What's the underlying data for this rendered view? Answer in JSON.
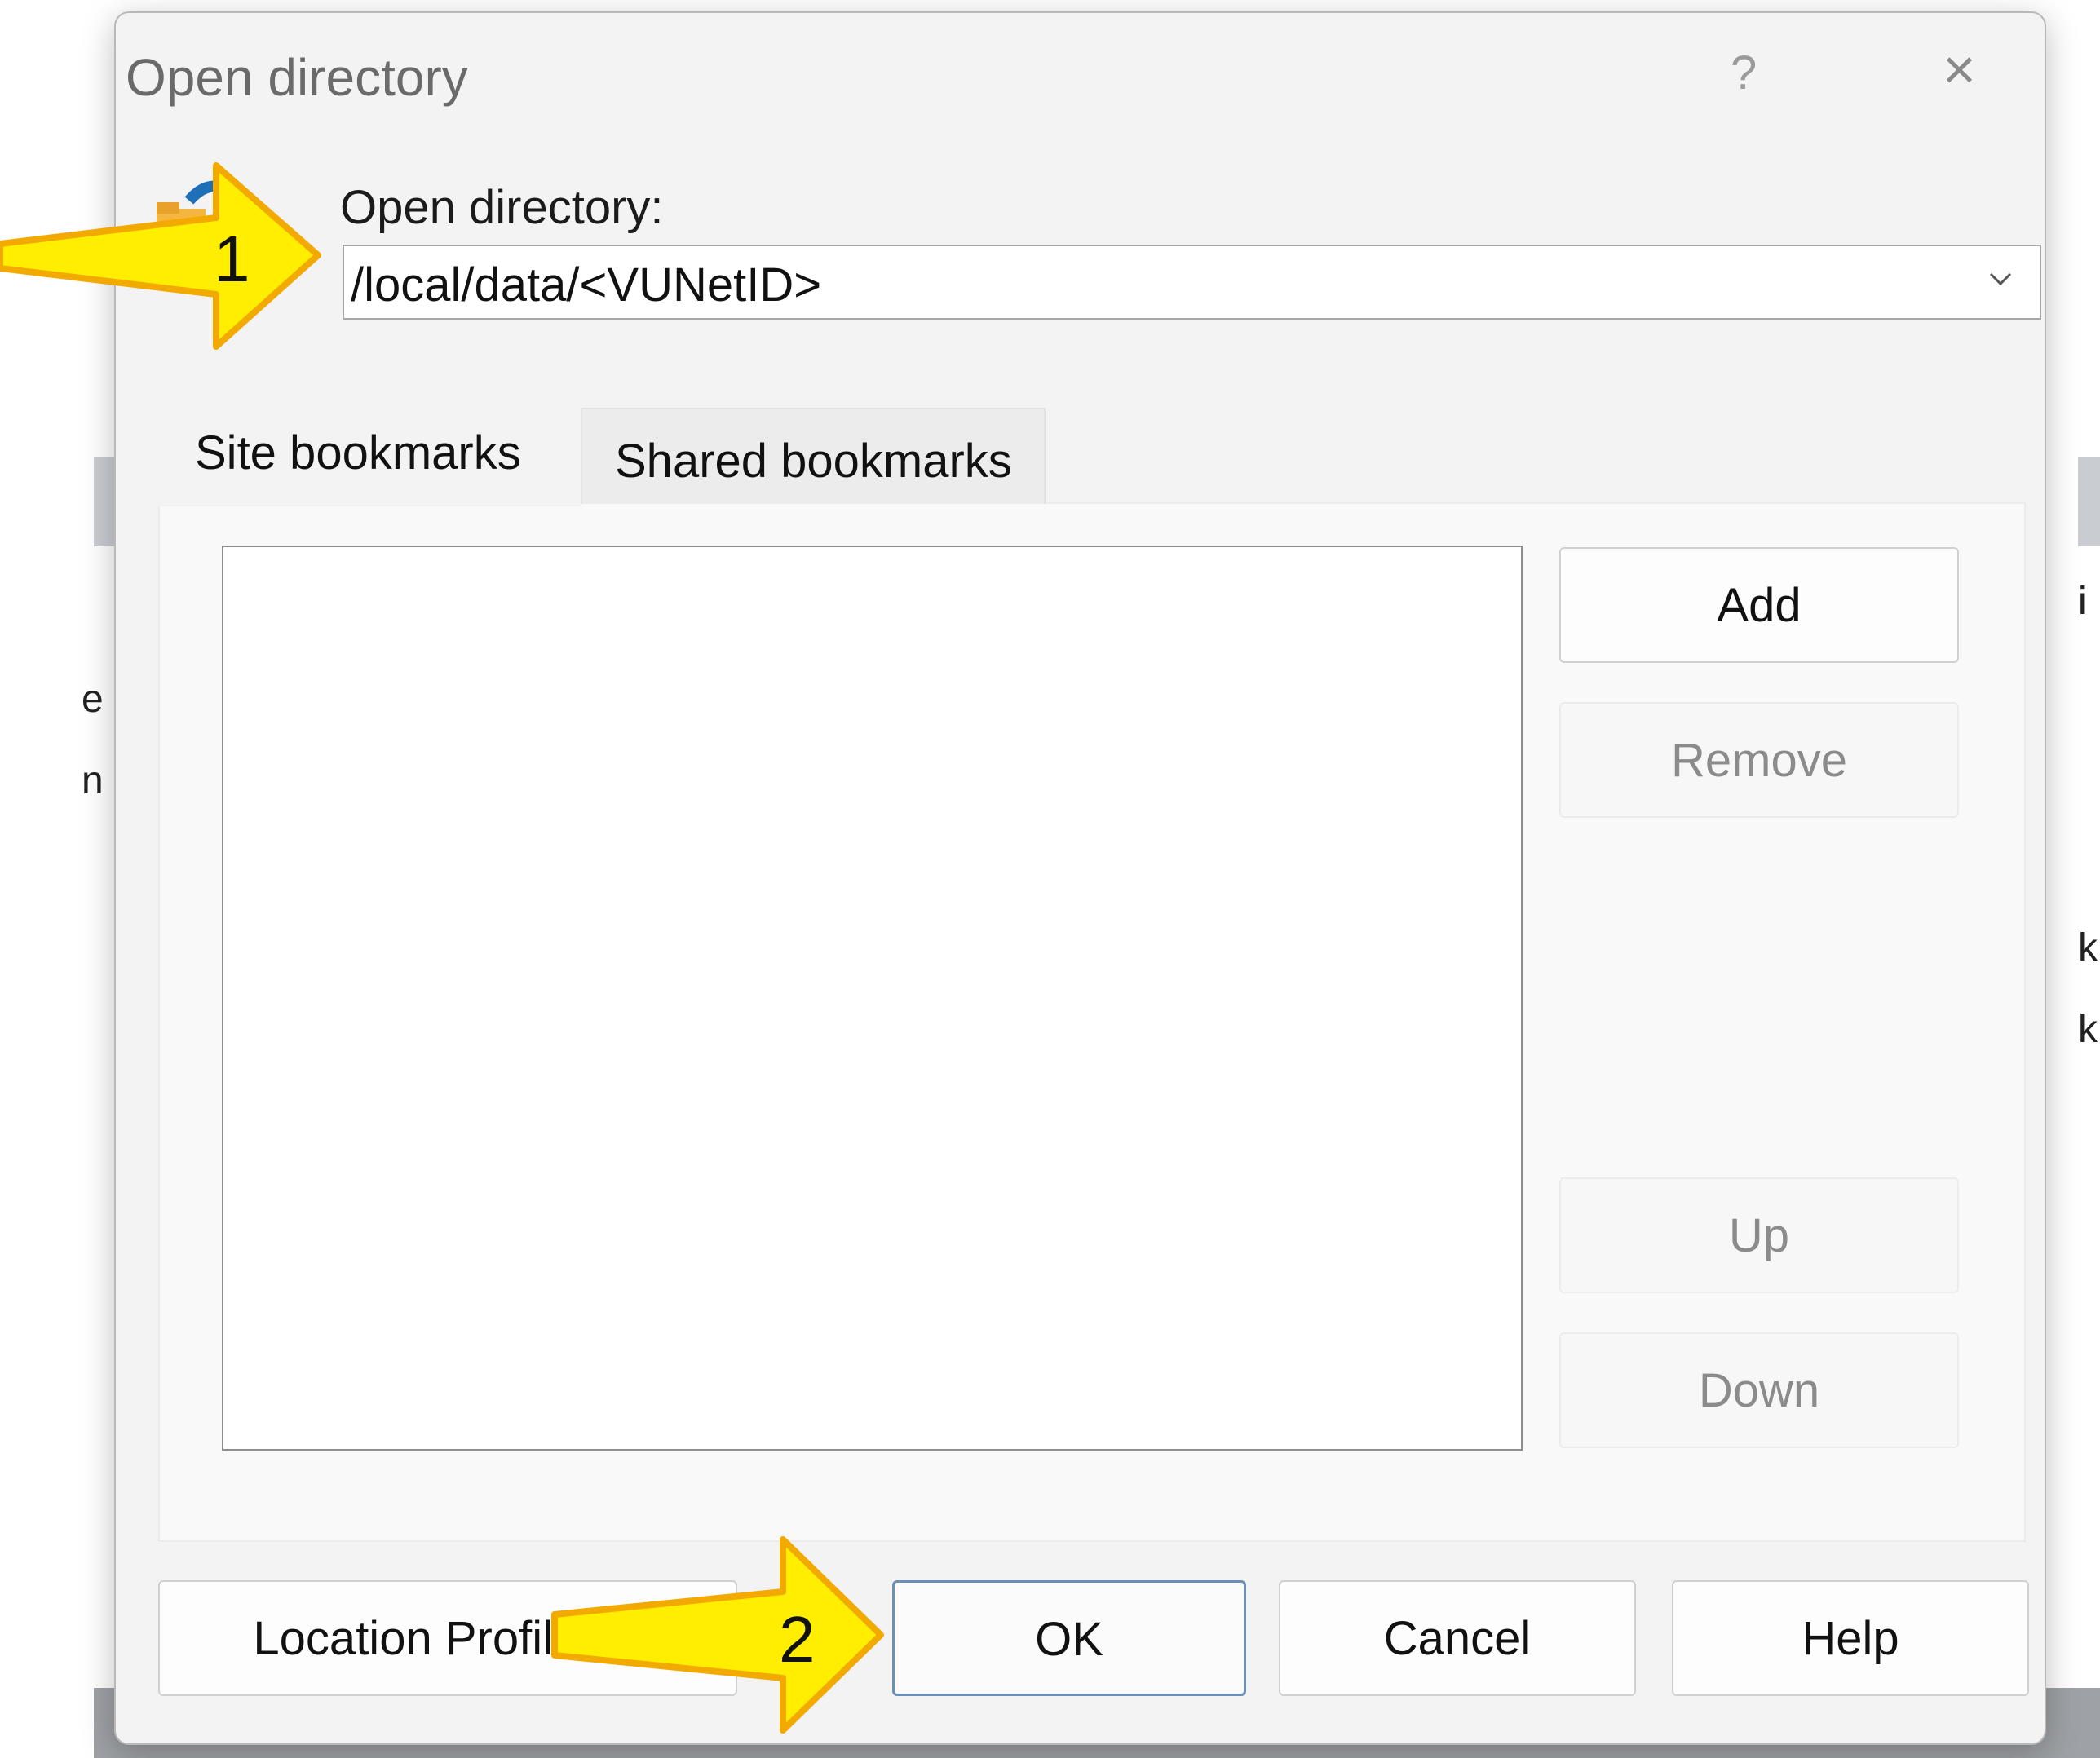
{
  "dialog": {
    "title": "Open directory",
    "help_symbol": "?",
    "close_symbol": "×"
  },
  "directory": {
    "label": "Open directory:",
    "value": "/local/data/<VUNetID>",
    "dropdown_icon": "chevron-down-icon"
  },
  "tabs": [
    {
      "label": "Site bookmarks",
      "active": true
    },
    {
      "label": "Shared bookmarks",
      "active": false
    }
  ],
  "bookmark_buttons": {
    "add": "Add",
    "remove": "Remove",
    "up": "Up",
    "down": "Down"
  },
  "footer_buttons": {
    "location_profiles": "Location Profiles...",
    "ok": "OK",
    "cancel": "Cancel",
    "help": "Help"
  },
  "annotations": {
    "arrow1_label": "1",
    "arrow2_label": "2",
    "arrow_color": "#ffee00",
    "arrow_outline": "#f2a900"
  },
  "background_fragments": {
    "left_1": "e",
    "left_2": "n",
    "right_1": "i",
    "right_2": "k",
    "right_3": "k"
  },
  "colors": {
    "default_button_border": "#6a8fb8",
    "dialog_bg": "#f3f3f3"
  }
}
